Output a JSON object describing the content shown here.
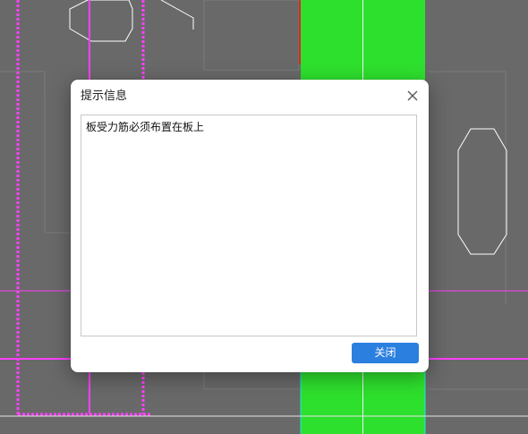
{
  "dialog": {
    "title": "提示信息",
    "message": "板受力筋必须布置在板上",
    "close_button_label": "关闭",
    "close_icon": "close-icon"
  },
  "colors": {
    "background": "#696969",
    "green_fill": "#2ee02e",
    "magenta_line": "#ff40ff",
    "cyan_line": "#1ae6e6",
    "red_line": "#e52222",
    "white_line": "#ffffff",
    "button_blue": "#2b7fde"
  }
}
